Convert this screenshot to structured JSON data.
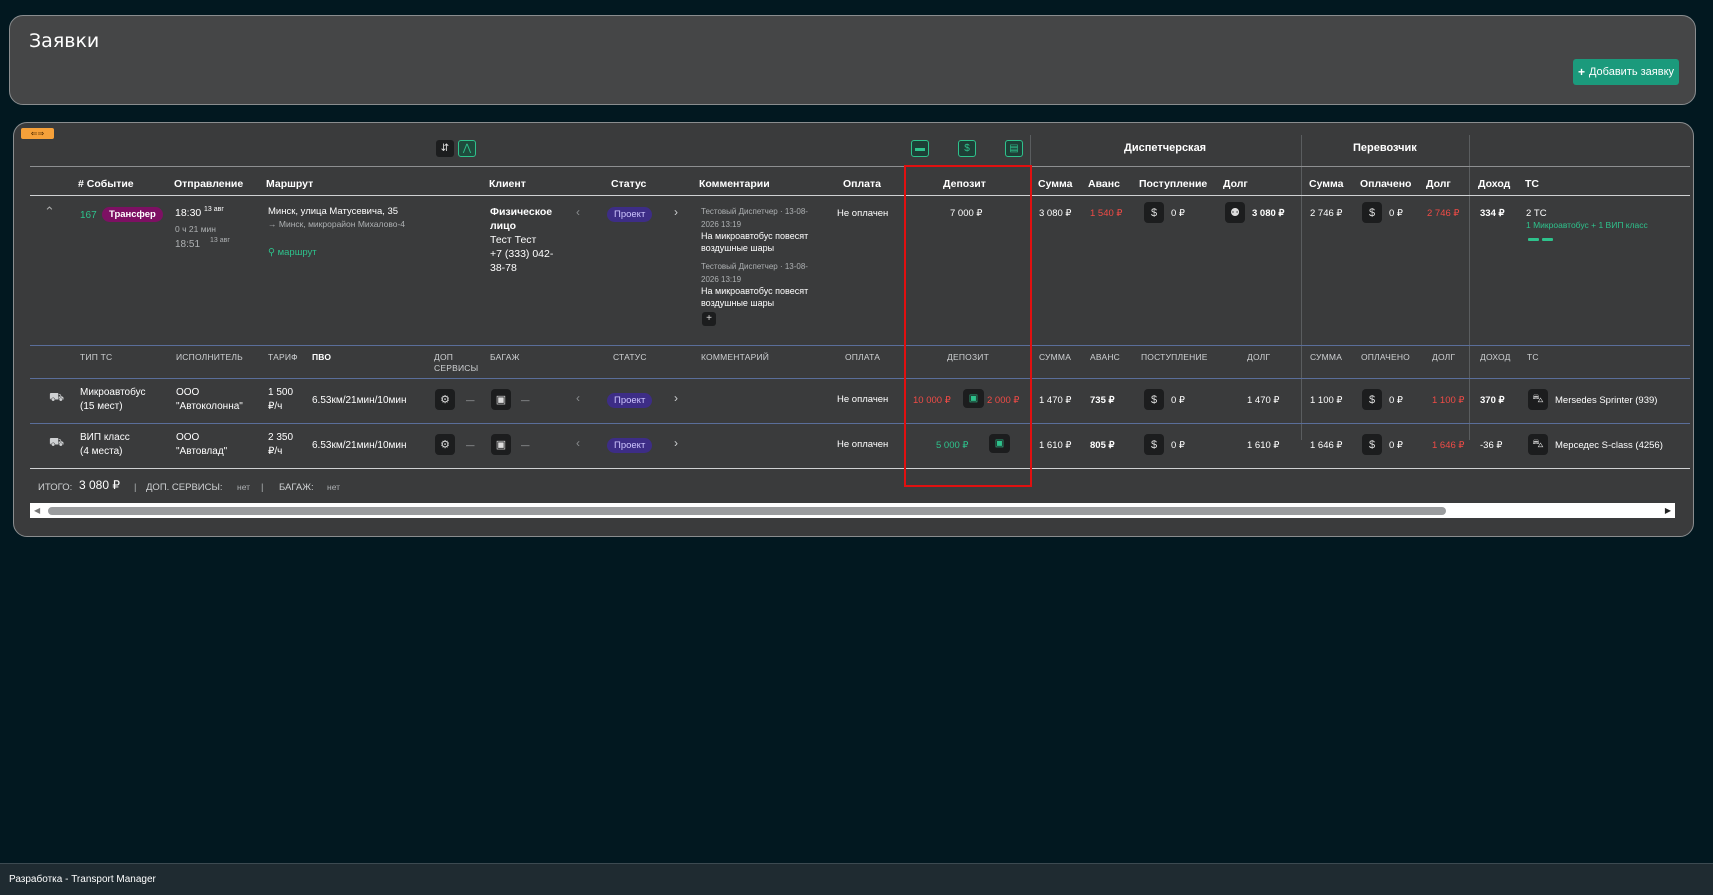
{
  "header": {
    "title": "Заявки",
    "add_button": "Добавить заявку"
  },
  "toolbar": {
    "toggle": "⇐⇒"
  },
  "groups": {
    "dispatch": "Диспетчерская",
    "carrier": "Перевозчик"
  },
  "columns": {
    "event": "# Событие",
    "departure": "Отправление",
    "route": "Маршрут",
    "client": "Клиент",
    "status": "Статус",
    "comments": "Комментарии",
    "payment": "Оплата",
    "deposit": "Депозит",
    "sum": "Сумма",
    "advance": "Аванс",
    "income_in": "Поступление",
    "debt": "Долг",
    "sum2": "Сумма",
    "paid": "Оплачено",
    "debt2": "Долг",
    "profit": "Доход",
    "vehicle": "ТС"
  },
  "order": {
    "id": "167",
    "type": "Трансфер",
    "dep_time": "18:30",
    "dep_date": "13 авг",
    "duration": "0 ч 21 мин",
    "arr_time": "18:51",
    "arr_date": "13 авг",
    "route_from": "Минск, улица Матусевича, 35",
    "route_to": "→ Минск, микрорайон Михалово-4",
    "route_link": "маршрут",
    "client_type": "Физическое",
    "client_type2": "лицо",
    "client_name": "Тест Тест",
    "client_phone": "+7 (333) 042-",
    "client_phone2": "38-78",
    "status": "Проект",
    "comments": [
      {
        "meta1": "Тестовый Диспетчер · 13-08-",
        "meta2": "2026 13:19",
        "text1": "На микроавтобус повесят",
        "text2": "воздушные шары"
      },
      {
        "meta1": "Тестовый Диспетчер · 13-08-",
        "meta2": "2026 13:19",
        "text1": "На микроавтобус повесят",
        "text2": "воздушные шары"
      }
    ],
    "payment": "Не оплачен",
    "deposit": "7 000 ₽",
    "sum": "3 080 ₽",
    "advance": "1 540 ₽",
    "income": "0 ₽",
    "debt": "3 080 ₽",
    "carrier_sum": "2 746 ₽",
    "carrier_paid": "0 ₽",
    "carrier_debt": "2 746 ₽",
    "profit": "334 ₽",
    "vehicles": "2 ТС",
    "vehicles_desc": "1 Микроавтобус + 1 ВИП класс"
  },
  "sub_columns": {
    "type": "ТИП ТС",
    "executor": "ИСПОЛНИТЕЛЬ",
    "tariff": "ТАРИФ",
    "pvo": "ПВО",
    "extra": "ДОП",
    "extra2": "СЕРВИСЫ",
    "baggage": "БАГАЖ",
    "status": "СТАТУС",
    "comment": "КОММЕНТАРИЙ",
    "payment": "ОПЛАТА",
    "deposit": "ДЕПОЗИТ",
    "sum": "СУММА",
    "advance": "АВАНС",
    "income": "ПОСТУПЛЕНИЕ",
    "debt": "ДОЛГ",
    "sum2": "СУММА",
    "paid": "ОПЛАЧЕНО",
    "debt2": "ДОЛГ",
    "profit": "ДОХОД",
    "vehicle": "ТС"
  },
  "sub_rows": [
    {
      "type1": "Микроавтобус",
      "type2": "(15 мест)",
      "exec1": "ООО",
      "exec2": "\"Автоколонна\"",
      "tariff1": "1 500",
      "tariff2": "₽/ч",
      "pvo": "6.53км/21мин/10мин",
      "extra": "—",
      "baggage": "—",
      "status": "Проект",
      "payment": "Не оплачен",
      "deposit_a": "10 000 ₽",
      "deposit_b": "2 000 ₽",
      "sum": "1 470 ₽",
      "advance": "735 ₽",
      "income": "0 ₽",
      "debt": "1 470 ₽",
      "c_sum": "1 100 ₽",
      "c_paid": "0 ₽",
      "c_debt": "1 100 ₽",
      "profit": "370 ₽",
      "vehicle": "Mersedes Sprinter (939)"
    },
    {
      "type1": "ВИП класс",
      "type2": "(4 места)",
      "exec1": "ООО",
      "exec2": "\"Автовлад\"",
      "tariff1": "2 350",
      "tariff2": "₽/ч",
      "pvo": "6.53км/21мин/10мин",
      "extra": "—",
      "baggage": "—",
      "status": "Проект",
      "payment": "Не оплачен",
      "deposit_a": "5 000 ₽",
      "sum": "1 610 ₽",
      "advance": "805 ₽",
      "income": "0 ₽",
      "debt": "1 610 ₽",
      "c_sum": "1 646 ₽",
      "c_paid": "0 ₽",
      "c_debt": "1 646 ₽",
      "profit": "-36 ₽",
      "vehicle": "Мерседес S-class (4256)"
    }
  ],
  "totals": {
    "label": "ИТОГО:",
    "value": "3 080 ₽",
    "extra_label": "ДОП. СЕРВИСЫ:",
    "extra_value": "нет",
    "baggage_label": "БАГАЖ:",
    "baggage_value": "нет"
  },
  "footer": {
    "text": "Разработка - Transport Manager"
  }
}
